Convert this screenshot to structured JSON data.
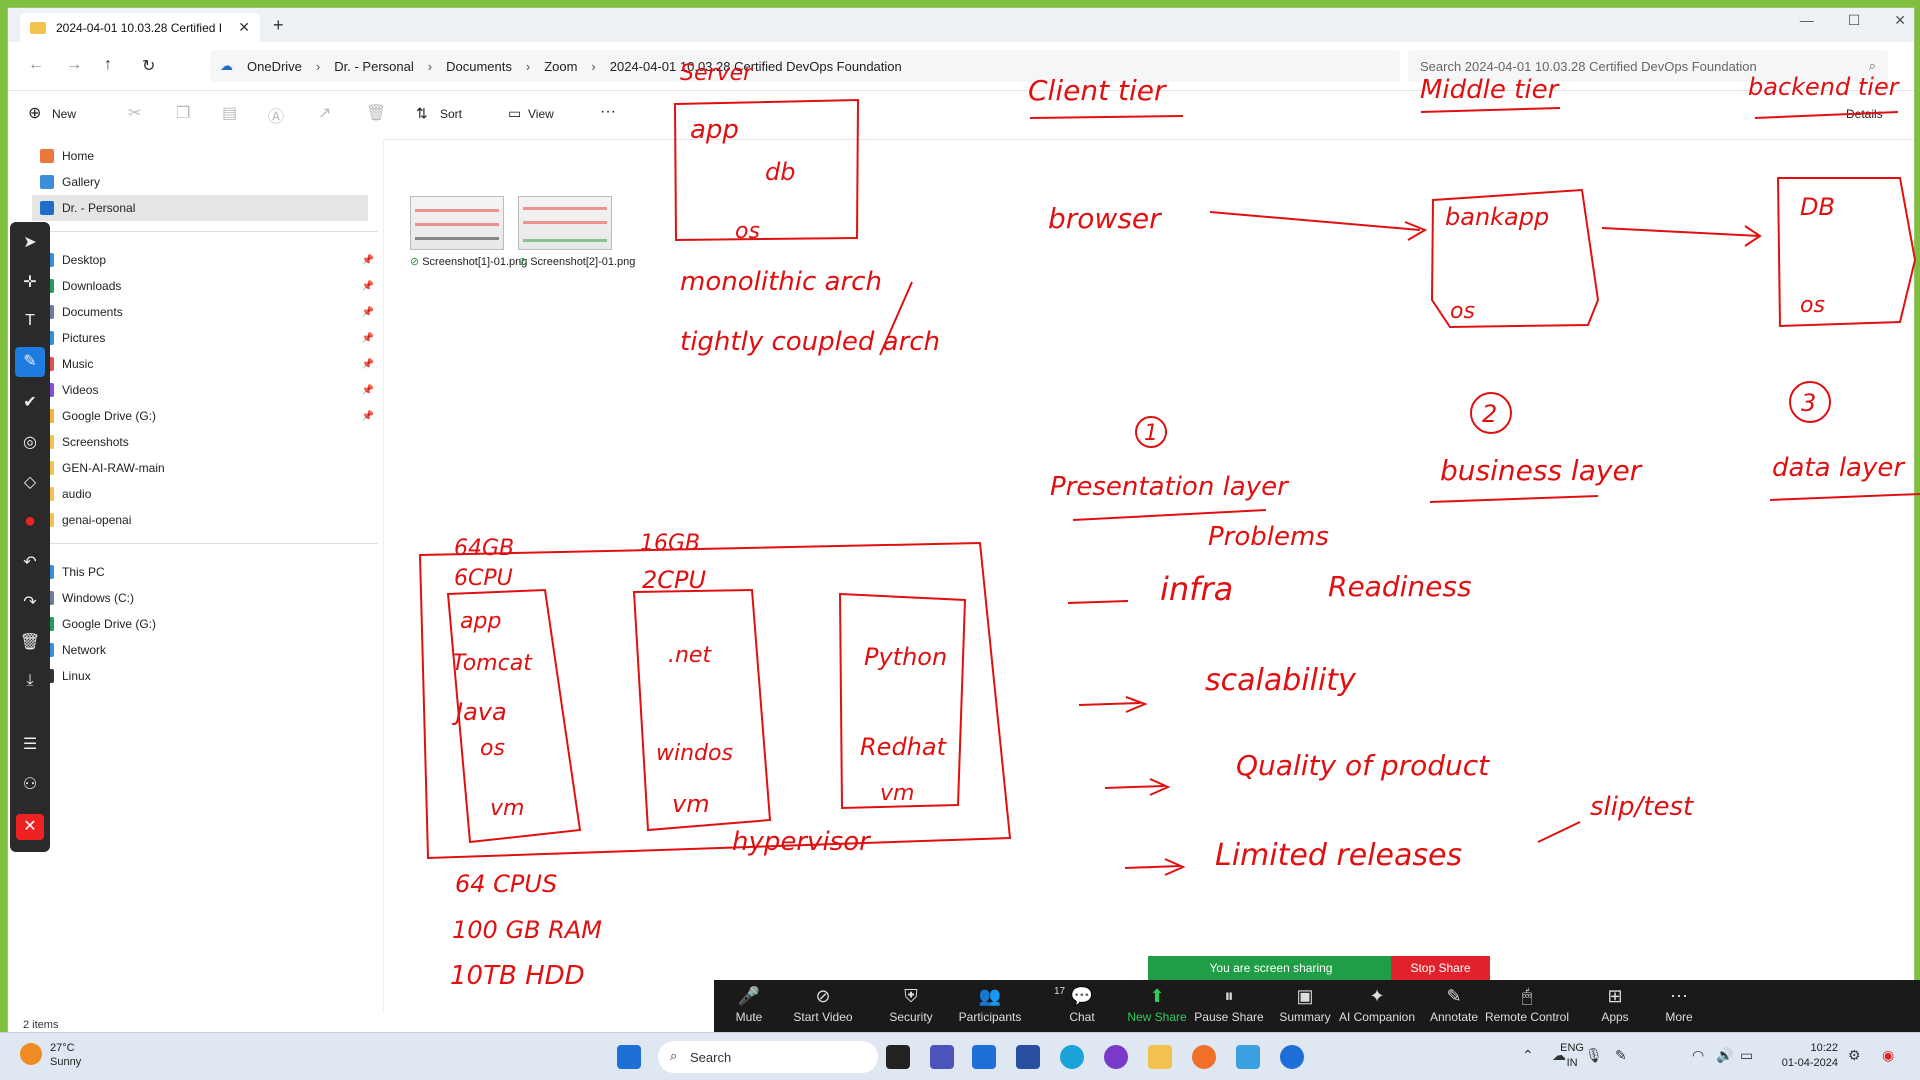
{
  "window": {
    "tab_title": "2024-04-01 10.03.28 Certified I",
    "new_tab": "+",
    "controls": [
      "—",
      "☐",
      "✕"
    ]
  },
  "address": {
    "breadcrumb": [
      "OneDrive",
      "Dr. - Personal",
      "Documents",
      "Zoom",
      "2024-04-01 10.03.28 Certified DevOps Foundation"
    ],
    "search_placeholder": "Search 2024-04-01 10.03.28 Certified DevOps Foundation"
  },
  "commands": {
    "new": "New",
    "sort": "Sort",
    "view": "View",
    "more": "···",
    "details": "Details"
  },
  "sidebar": {
    "top": [
      {
        "label": "Home",
        "color": "#e8793a"
      },
      {
        "label": "Gallery",
        "color": "#3b8fd9"
      },
      {
        "label": "Dr. - Personal",
        "color": "#1f6fc9"
      }
    ],
    "quick": [
      {
        "label": "Desktop",
        "color": "#3b8fd9"
      },
      {
        "label": "Downloads",
        "color": "#2a9a5a"
      },
      {
        "label": "Documents",
        "color": "#6a7fa0"
      },
      {
        "label": "Pictures",
        "color": "#2f8fd9"
      },
      {
        "label": "Music",
        "color": "#e05050"
      },
      {
        "label": "Videos",
        "color": "#8a4fd0"
      },
      {
        "label": "Google Drive (G:)",
        "color": "#f2b632"
      },
      {
        "label": "Screenshots",
        "color": "#f2c14e"
      },
      {
        "label": "GEN-AI-RAW-main",
        "color": "#f2c14e"
      },
      {
        "label": "audio",
        "color": "#f2c14e"
      },
      {
        "label": "genai-openai",
        "color": "#f2c14e"
      }
    ],
    "devices": [
      {
        "label": "This PC",
        "color": "#3b8fd9"
      },
      {
        "label": "Windows (C:)",
        "color": "#6a7fa0"
      },
      {
        "label": "Google Drive (G:)",
        "color": "#2a9a5a"
      },
      {
        "label": "Network",
        "color": "#3b8fd9"
      },
      {
        "label": "Linux",
        "color": "#333333"
      }
    ]
  },
  "files": [
    {
      "name": "Screenshot[1]-01.png"
    },
    {
      "name": "Screenshot[2]-01.png"
    }
  ],
  "status": "2 items",
  "ink": {
    "server": "Server",
    "app": "app",
    "db": "db",
    "os": "os",
    "monolithic": "monolithic arch",
    "tightly": "tightly coupled arch",
    "client_tier": "Client tier",
    "middle_tier": "Middle tier",
    "backend_tier": "backend tier",
    "browser": "browser",
    "bankapp": "bankapp",
    "os2": "os",
    "db2": "DB",
    "os3": "os",
    "n1": "1",
    "n2": "2",
    "n3": "3",
    "presentation": "Presentation layer",
    "business": "business layer",
    "data": "data layer",
    "problems": "Problems",
    "infra": "infra",
    "readiness": "Readiness",
    "scalability": "scalability",
    "quality": "Quality of product",
    "limited": "Limited releases",
    "slip": "slip/test",
    "g64": "64GB",
    "cpu6": "6CPU",
    "g16": "16GB",
    "cpu2": "2CPU",
    "vm1": [
      "app",
      "Tomcat",
      "Java",
      "os",
      "vm"
    ],
    "vm2": [
      ".net",
      "windos",
      "vm"
    ],
    "vm3": [
      "Python",
      "Redhat",
      "vm"
    ],
    "hypervisor": "hypervisor",
    "cpus64": "64 CPUS",
    "ram": "100 GB RAM",
    "hdd": "10TB HDD"
  },
  "zoom": {
    "sharing": "You are screen sharing",
    "stop": "Stop Share",
    "participants_count": "17",
    "buttons": [
      "Mute",
      "Start Video",
      "Security",
      "Participants",
      "Chat",
      "New Share",
      "Pause Share",
      "Summary",
      "AI Companion",
      "Annotate",
      "Remote Control",
      "Apps",
      "More"
    ]
  },
  "taskbar": {
    "temp": "27°C",
    "cond": "Sunny",
    "search": "Search",
    "lang1": "ENG",
    "lang2": "IN",
    "time": "10:22",
    "date": "01-04-2024"
  }
}
